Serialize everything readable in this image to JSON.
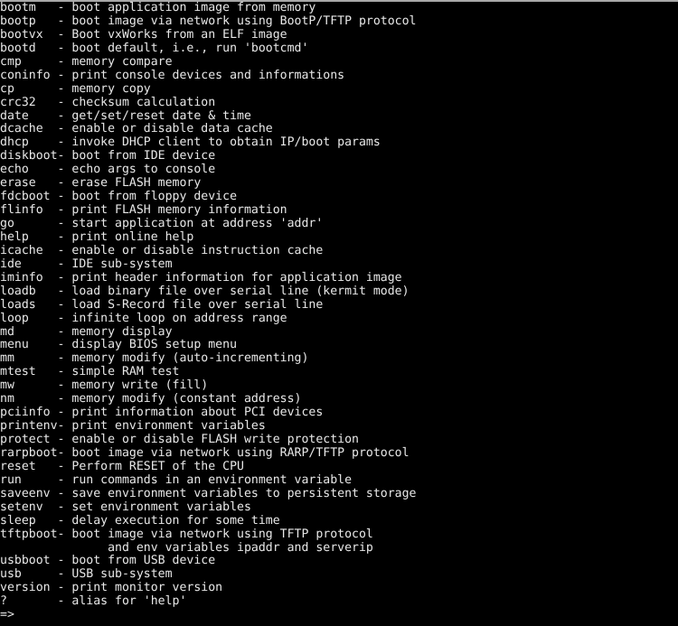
{
  "terminal": {
    "colors": {
      "background": "#000000",
      "foreground": "#e8e8e8",
      "border": "#a8a8a8"
    },
    "lines": [
      "bootm   - boot application image from memory",
      "bootp   - boot image via network using BootP/TFTP protocol",
      "bootvx  - Boot vxWorks from an ELF image",
      "bootd   - boot default, i.e., run 'bootcmd'",
      "cmp     - memory compare",
      "coninfo - print console devices and informations",
      "cp      - memory copy",
      "crc32   - checksum calculation",
      "date    - get/set/reset date & time",
      "dcache  - enable or disable data cache",
      "dhcp    - invoke DHCP client to obtain IP/boot params",
      "diskboot- boot from IDE device",
      "echo    - echo args to console",
      "erase   - erase FLASH memory",
      "fdcboot - boot from floppy device",
      "flinfo  - print FLASH memory information",
      "go      - start application at address 'addr'",
      "help    - print online help",
      "icache  - enable or disable instruction cache",
      "ide     - IDE sub-system",
      "iminfo  - print header information for application image",
      "loadb   - load binary file over serial line (kermit mode)",
      "loads   - load S-Record file over serial line",
      "loop    - infinite loop on address range",
      "md      - memory display",
      "menu    - display BIOS setup menu",
      "mm      - memory modify (auto-incrementing)",
      "mtest   - simple RAM test",
      "mw      - memory write (fill)",
      "nm      - memory modify (constant address)",
      "pciinfo - print information about PCI devices",
      "printenv- print environment variables",
      "protect - enable or disable FLASH write protection",
      "rarpboot- boot image via network using RARP/TFTP protocol",
      "reset   - Perform RESET of the CPU",
      "run     - run commands in an environment variable",
      "saveenv - save environment variables to persistent storage",
      "setenv  - set environment variables",
      "sleep   - delay execution for some time",
      "tftpboot- boot image via network using TFTP protocol",
      "               and env variables ipaddr and serverip",
      "usbboot - boot from USB device",
      "usb     - USB sub-system",
      "version - print monitor version",
      "?       - alias for 'help'"
    ],
    "prompt": "=>",
    "command_input": ""
  }
}
